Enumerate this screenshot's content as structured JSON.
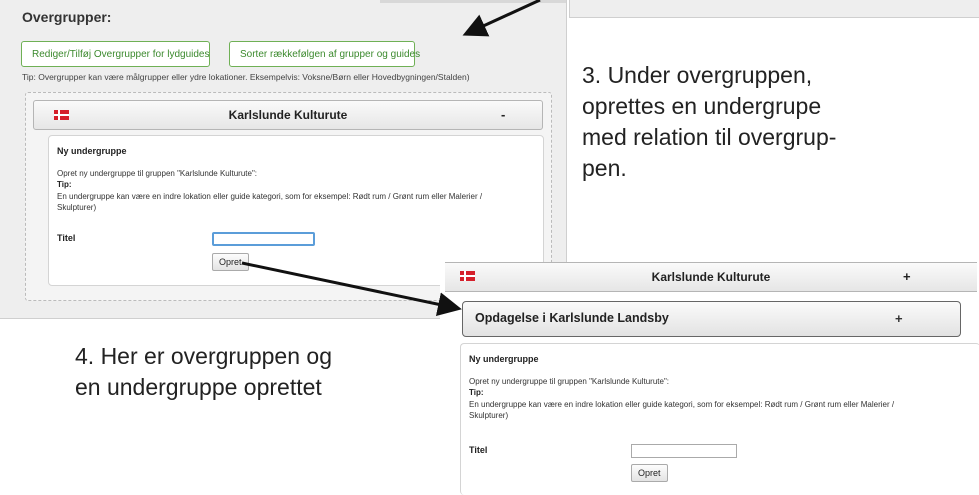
{
  "left_panel": {
    "section_title": "Overgrupper:",
    "buttons": {
      "edit": "Rediger/Tilføj Overgrupper for lydguides",
      "sort": "Sorter rækkefølgen af grupper og guides"
    },
    "tip": "Tip: Overgrupper kan være målgrupper eller ydre lokationer. Eksempelvis: Voksne/Børn eller Hovedbygningen/Stalden)",
    "group": {
      "title": "Karlslunde Kulturute",
      "toggle": "-"
    },
    "new_subgroup": {
      "title": "Ny undergruppe",
      "line1": "Opret ny undergruppe til gruppen \"Karlslunde Kulturute\":",
      "tip_label": "Tip:",
      "line2": "En undergruppe kan være en indre lokation eller guide kategori, som for eksempel: Rødt rum / Grønt rum eller Malerier /",
      "line3": "Skulpturer)",
      "field_label": "Titel",
      "field_value": "",
      "button": "Opret"
    }
  },
  "annotations": {
    "step3": [
      "3. Under overgruppen,",
      "oprettes en undergrupe",
      "med relation til overgrup-",
      "pen."
    ],
    "step4": [
      "4. Her er overgruppen og",
      "en undergruppe oprettet"
    ]
  },
  "right_panel": {
    "group": {
      "title": "Karlslunde Kulturute",
      "toggle": "+"
    },
    "subgroup": {
      "title": "Opdagelse i Karlslunde Landsby",
      "toggle": "+"
    },
    "new_subgroup": {
      "title": "Ny undergruppe",
      "line1": "Opret ny undergruppe til gruppen \"Karlslunde Kulturute\":",
      "tip_label": "Tip:",
      "line2": "En undergruppe kan være en indre lokation eller guide kategori, som for eksempel: Rødt rum / Grønt rum eller Malerier /",
      "line3": "Skulpturer)",
      "field_label": "Titel",
      "field_value": "",
      "button": "Opret"
    }
  },
  "colors": {
    "button_border": "#6fb055",
    "button_text": "#3c8a2e",
    "flag_red": "#d5202b",
    "panel_bg": "#eeeeee"
  },
  "icons": [
    "flag-denmark-icon",
    "arrow-icon"
  ]
}
